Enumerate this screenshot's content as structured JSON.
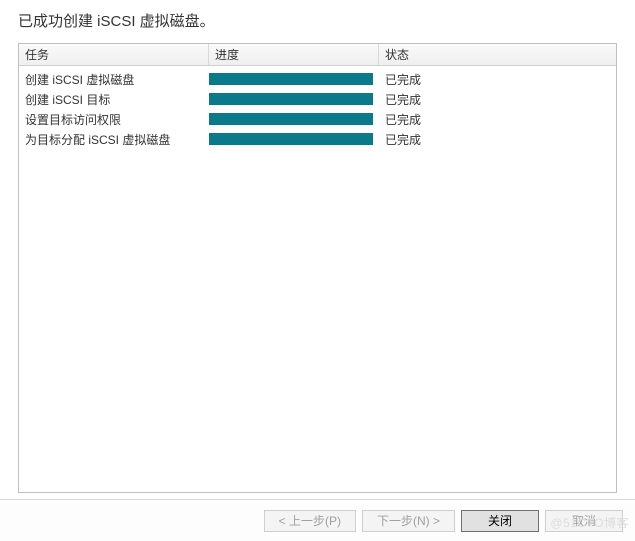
{
  "heading": "已成功创建 iSCSI 虚拟磁盘。",
  "columns": {
    "task": "任务",
    "progress": "进度",
    "status": "状态"
  },
  "tasks": [
    {
      "name": "创建 iSCSI 虚拟磁盘",
      "progress": 100,
      "status": "已完成"
    },
    {
      "name": "创建 iSCSI 目标",
      "progress": 100,
      "status": "已完成"
    },
    {
      "name": "设置目标访问权限",
      "progress": 100,
      "status": "已完成"
    },
    {
      "name": "为目标分配 iSCSI 虚拟磁盘",
      "progress": 100,
      "status": "已完成"
    }
  ],
  "buttons": {
    "previous": "< 上一步(P)",
    "next": "下一步(N) >",
    "close": "关闭",
    "cancel": "取消"
  },
  "watermark": "@51CTO博客"
}
